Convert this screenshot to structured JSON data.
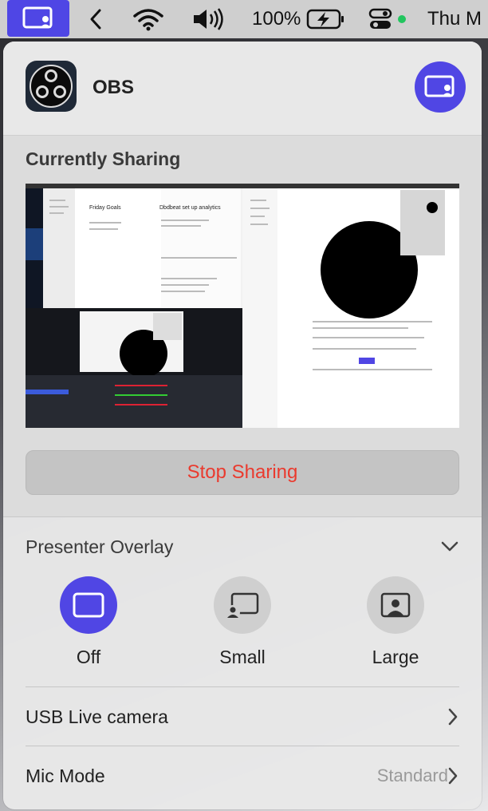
{
  "menubar": {
    "battery_percent": "100%",
    "day": "Thu M",
    "icons": [
      "screen-share-icon",
      "chevron-left-icon",
      "wifi-icon",
      "volume-icon",
      "battery-charging-icon",
      "control-center-icon",
      "status-dot-icon"
    ],
    "status_dot_color": "#22c55e"
  },
  "header": {
    "app_name": "OBS",
    "accent": "#5046e4"
  },
  "sharing": {
    "title": "Currently Sharing",
    "preview": {
      "doc_title": "Friday Goals",
      "doc_heading": "Dbdbeat set up analytics"
    },
    "stop_label": "Stop Sharing",
    "stop_color": "#ea3a2e"
  },
  "presenter_overlay": {
    "title": "Presenter Overlay",
    "options": [
      {
        "label": "Off",
        "selected": true,
        "icon": "window-icon"
      },
      {
        "label": "Small",
        "selected": false,
        "icon": "small-overlay-icon"
      },
      {
        "label": "Large",
        "selected": false,
        "icon": "large-overlay-icon"
      }
    ]
  },
  "rows": [
    {
      "label": "USB  Live camera",
      "value": ""
    },
    {
      "label": "Mic Mode",
      "value": "Standard"
    }
  ]
}
